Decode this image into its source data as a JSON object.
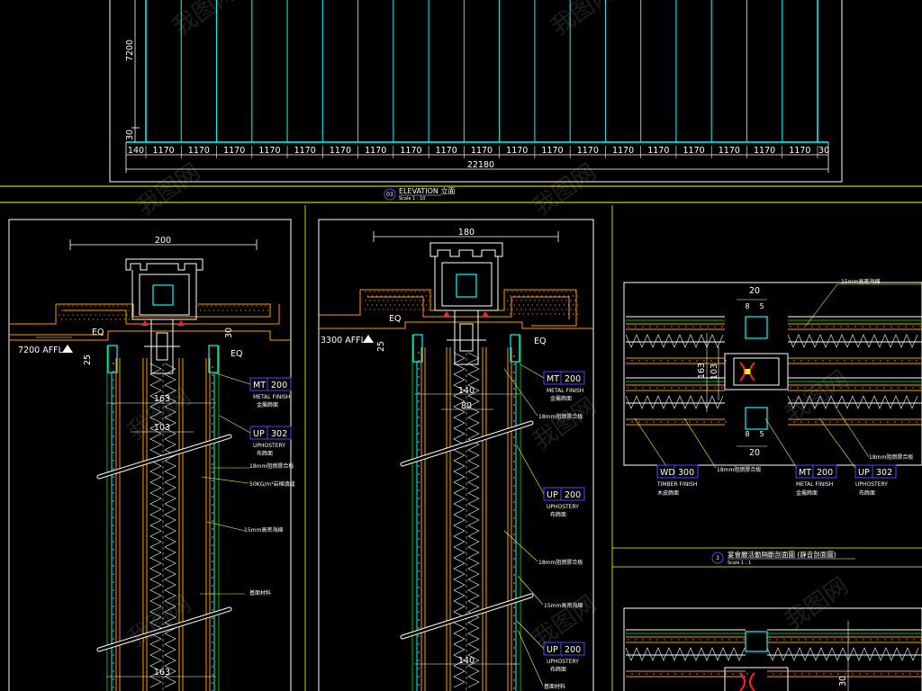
{
  "elevation": {
    "height_label": "7200",
    "bottom_offset_label": "30",
    "left_edge_label": "140",
    "right_edge_label": "30",
    "module_label": "1170",
    "module_count": 19,
    "total_label": "22180",
    "title_number": "03",
    "title": "ELEVATION 立面",
    "scale": "Scale 1 : 10"
  },
  "section_a": {
    "top_width": "200",
    "level_label": "7200 AFFL",
    "eq_label": "EQ",
    "eq_label_right": "EQ",
    "dim_25": "25",
    "dim_30": "30",
    "dim_163_top": "163",
    "dim_103": "103",
    "dim_163_bottom": "163",
    "tags": [
      {
        "code": "MT",
        "num": "200",
        "en": "METAL FINISH",
        "cn": "金屬飾面"
      },
      {
        "code": "UP",
        "num": "302",
        "en": "UPHOSTERY",
        "cn": "布飾面"
      }
    ],
    "notes": [
      "18mm阻燃膠合板",
      "50KG/m³岩棉填縫",
      "15mm高密海綿",
      "基面材料"
    ]
  },
  "section_b": {
    "top_width": "180",
    "level_label": "3300 AFFL",
    "eq_label": "EQ",
    "eq_label_right": "EQ",
    "dim_25": "25",
    "dim_140_top": "140",
    "dim_80": "80",
    "dim_140_bottom": "140",
    "tags": [
      {
        "code": "MT",
        "num": "200",
        "en": "METAL FINISH",
        "cn": "金屬飾面"
      },
      {
        "code": "UP",
        "num": "200",
        "en": "UPHOSTERY",
        "cn": "布飾面"
      },
      {
        "code": "UP",
        "num": "200",
        "en": "UPHOSTERY",
        "cn": "布飾面"
      }
    ],
    "notes": [
      "18mm阻燃膠合板",
      "18mm阻燃膠合板",
      "15mm高密海綿",
      "基面材料"
    ]
  },
  "section_c": {
    "dim_20_top": "20",
    "dim_8_top": "8",
    "dim_5_top": "5",
    "dim_163": "163",
    "dim_103": "103",
    "dim_8_bottom": "8",
    "dim_5_bottom": "5",
    "dim_20_bottom": "20",
    "note_top": "15mm高密海綿",
    "note_right": "18mm阻燃膠合板",
    "note_mid": "18mm阻燃膠合板",
    "tags": [
      {
        "code": "WD",
        "num": "300",
        "en": "TIMBER FINISH",
        "cn": "木皮飾面"
      },
      {
        "code": "MT",
        "num": "200",
        "en": "METAL FINISH",
        "cn": "金屬飾面"
      },
      {
        "code": "UP",
        "num": "302",
        "en": "UPHOSTERY",
        "cn": "布飾面"
      }
    ],
    "title_number": "3",
    "title": "宴會廳活動隔斷剖面圖 (靜音剖面圖)",
    "scale": "Scale 1 : 1",
    "dim_30": "30"
  },
  "watermark": "我图网",
  "colors": {
    "background": "#000000",
    "cyan": "#00ffff",
    "yellow": "#ffff00",
    "orange": "#ff9900",
    "white": "#ffffff",
    "blue": "#4a4aff",
    "magenta": "#ff00ff",
    "red": "#ff2020",
    "green": "#00c000"
  }
}
